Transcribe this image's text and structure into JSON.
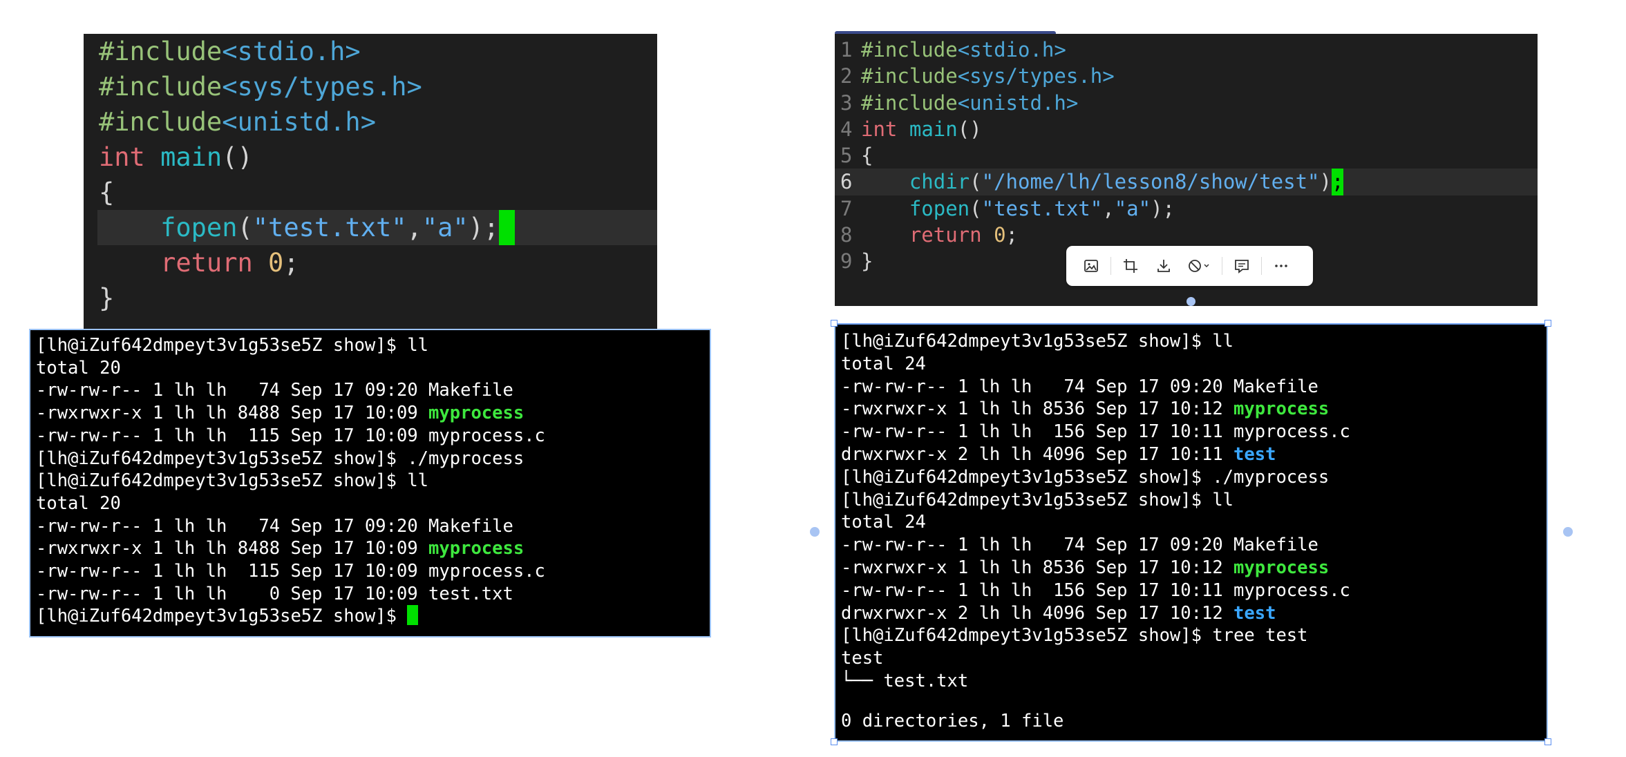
{
  "left_editor": {
    "lines": [
      {
        "id": "l1",
        "tokens": [
          {
            "t": "#include",
            "c": "kw-green"
          },
          {
            "t": "<stdio.h>",
            "c": "hdr"
          }
        ]
      },
      {
        "id": "l2",
        "tokens": [
          {
            "t": "#include",
            "c": "kw-green"
          },
          {
            "t": "<sys/types.h>",
            "c": "hdr"
          }
        ]
      },
      {
        "id": "l3",
        "tokens": [
          {
            "t": "#include",
            "c": "kw-green"
          },
          {
            "t": "<unistd.h>",
            "c": "hdr"
          }
        ]
      },
      {
        "id": "l4",
        "tokens": [
          {
            "t": "int",
            "c": "kw-red"
          },
          {
            "t": " ",
            "c": "plain"
          },
          {
            "t": "main",
            "c": "kw-teal"
          },
          {
            "t": "()",
            "c": "plain"
          }
        ]
      },
      {
        "id": "l5",
        "tokens": [
          {
            "t": "{",
            "c": "plain"
          }
        ]
      },
      {
        "id": "l6",
        "active": true,
        "tokens": [
          {
            "t": "    ",
            "c": "plain"
          },
          {
            "t": "fopen",
            "c": "kw-teal"
          },
          {
            "t": "(",
            "c": "plain"
          },
          {
            "t": "\"test.txt\"",
            "c": "str"
          },
          {
            "t": ",",
            "c": "plain"
          },
          {
            "t": "\"a\"",
            "c": "str"
          },
          {
            "t": ");",
            "c": "plain"
          },
          {
            "t": " ",
            "c": "cursor-block"
          }
        ]
      },
      {
        "id": "l7",
        "tokens": [
          {
            "t": "    ",
            "c": "plain"
          },
          {
            "t": "return",
            "c": "kw-red"
          },
          {
            "t": " ",
            "c": "plain"
          },
          {
            "t": "0",
            "c": "num"
          },
          {
            "t": ";",
            "c": "plain"
          }
        ]
      },
      {
        "id": "l8",
        "tokens": [
          {
            "t": "}",
            "c": "plain"
          }
        ]
      }
    ]
  },
  "right_editor": {
    "lines": [
      {
        "n": "1",
        "tokens": [
          {
            "t": "#include",
            "c": "kw-green"
          },
          {
            "t": "<stdio.h>",
            "c": "hdr"
          }
        ]
      },
      {
        "n": "2",
        "tokens": [
          {
            "t": "#include",
            "c": "kw-green"
          },
          {
            "t": "<sys/types.h>",
            "c": "hdr"
          }
        ]
      },
      {
        "n": "3",
        "tokens": [
          {
            "t": "#include",
            "c": "kw-green"
          },
          {
            "t": "<unistd.h>",
            "c": "hdr"
          }
        ]
      },
      {
        "n": "4",
        "tokens": [
          {
            "t": "int",
            "c": "kw-red"
          },
          {
            "t": " ",
            "c": "plain"
          },
          {
            "t": "main",
            "c": "kw-teal"
          },
          {
            "t": "()",
            "c": "plain"
          }
        ]
      },
      {
        "n": "5",
        "tokens": [
          {
            "t": "{",
            "c": "plain"
          }
        ]
      },
      {
        "n": "6",
        "active": true,
        "tokens": [
          {
            "t": "    ",
            "c": "plain"
          },
          {
            "t": "chdir",
            "c": "kw-teal"
          },
          {
            "t": "(",
            "c": "plain"
          },
          {
            "t": "\"/home/lh/lesson8/show/test\"",
            "c": "str"
          },
          {
            "t": ")",
            "c": "plain"
          },
          {
            "t": ";",
            "c": "cursor-block"
          }
        ]
      },
      {
        "n": "7",
        "tokens": [
          {
            "t": "    ",
            "c": "plain"
          },
          {
            "t": "fopen",
            "c": "kw-teal"
          },
          {
            "t": "(",
            "c": "plain"
          },
          {
            "t": "\"test.txt\"",
            "c": "str"
          },
          {
            "t": ",",
            "c": "plain"
          },
          {
            "t": "\"a\"",
            "c": "str"
          },
          {
            "t": ");",
            "c": "plain"
          }
        ]
      },
      {
        "n": "8",
        "tokens": [
          {
            "t": "    ",
            "c": "plain"
          },
          {
            "t": "return",
            "c": "kw-red"
          },
          {
            "t": " ",
            "c": "plain"
          },
          {
            "t": "0",
            "c": "num"
          },
          {
            "t": ";",
            "c": "plain"
          }
        ]
      },
      {
        "n": "9",
        "tokens": [
          {
            "t": "}",
            "c": "plain"
          }
        ]
      }
    ]
  },
  "left_terminal": {
    "lines": [
      [
        {
          "t": "[lh@iZuf642dmpeyt3v1g53se5Z show]$ ll"
        }
      ],
      [
        {
          "t": "total 20"
        }
      ],
      [
        {
          "t": "-rw-rw-r-- 1 lh lh   74 Sep 17 09:20 Makefile"
        }
      ],
      [
        {
          "t": "-rwxrwxr-x 1 lh lh 8488 Sep 17 10:09 "
        },
        {
          "t": "myprocess",
          "c": "green-b"
        }
      ],
      [
        {
          "t": "-rw-rw-r-- 1 lh lh  115 Sep 17 10:09 myprocess.c"
        }
      ],
      [
        {
          "t": "[lh@iZuf642dmpeyt3v1g53se5Z show]$ ./myprocess"
        }
      ],
      [
        {
          "t": "[lh@iZuf642dmpeyt3v1g53se5Z show]$ ll"
        }
      ],
      [
        {
          "t": "total 20"
        }
      ],
      [
        {
          "t": "-rw-rw-r-- 1 lh lh   74 Sep 17 09:20 Makefile"
        }
      ],
      [
        {
          "t": "-rwxrwxr-x 1 lh lh 8488 Sep 17 10:09 "
        },
        {
          "t": "myprocess",
          "c": "green-b"
        }
      ],
      [
        {
          "t": "-rw-rw-r-- 1 lh lh  115 Sep 17 10:09 myprocess.c"
        }
      ],
      [
        {
          "t": "-rw-rw-r-- 1 lh lh    0 Sep 17 10:09 test.txt"
        }
      ],
      [
        {
          "t": "[lh@iZuf642dmpeyt3v1g53se5Z show]$ "
        },
        {
          "t": "",
          "c": "tcursor"
        }
      ]
    ]
  },
  "right_terminal": {
    "lines": [
      [
        {
          "t": "[lh@iZuf642dmpeyt3v1g53se5Z show]$ ll"
        }
      ],
      [
        {
          "t": "total 24"
        }
      ],
      [
        {
          "t": "-rw-rw-r-- 1 lh lh   74 Sep 17 09:20 Makefile"
        }
      ],
      [
        {
          "t": "-rwxrwxr-x 1 lh lh 8536 Sep 17 10:12 "
        },
        {
          "t": "myprocess",
          "c": "green-b"
        }
      ],
      [
        {
          "t": "-rw-rw-r-- 1 lh lh  156 Sep 17 10:11 myprocess.c"
        }
      ],
      [
        {
          "t": "drwxrwxr-x 2 lh lh 4096 Sep 17 10:11 "
        },
        {
          "t": "test",
          "c": "blue-b"
        }
      ],
      [
        {
          "t": "[lh@iZuf642dmpeyt3v1g53se5Z show]$ ./myprocess"
        }
      ],
      [
        {
          "t": "[lh@iZuf642dmpeyt3v1g53se5Z show]$ ll"
        }
      ],
      [
        {
          "t": "total 24"
        }
      ],
      [
        {
          "t": "-rw-rw-r-- 1 lh lh   74 Sep 17 09:20 Makefile"
        }
      ],
      [
        {
          "t": "-rwxrwxr-x 1 lh lh 8536 Sep 17 10:12 "
        },
        {
          "t": "myprocess",
          "c": "green-b"
        }
      ],
      [
        {
          "t": "-rw-rw-r-- 1 lh lh  156 Sep 17 10:11 myprocess.c"
        }
      ],
      [
        {
          "t": "drwxrwxr-x 2 lh lh 4096 Sep 17 10:12 "
        },
        {
          "t": "test",
          "c": "blue-b"
        }
      ],
      [
        {
          "t": "[lh@iZuf642dmpeyt3v1g53se5Z show]$ tree test"
        }
      ],
      [
        {
          "t": "test"
        }
      ],
      [
        {
          "t": "└── test.txt"
        }
      ],
      [
        {
          "t": ""
        }
      ],
      [
        {
          "t": "0 directories, 1 file"
        }
      ]
    ]
  },
  "image_toolbar": {
    "buttons": [
      {
        "name": "image-icon",
        "label": "Image"
      },
      {
        "name": "crop-icon",
        "label": "Crop"
      },
      {
        "name": "download-icon",
        "label": "Download"
      },
      {
        "name": "block-icon",
        "label": "Block"
      },
      {
        "name": "comment-icon",
        "label": "Comment"
      },
      {
        "name": "more-icon",
        "label": "More"
      }
    ]
  }
}
